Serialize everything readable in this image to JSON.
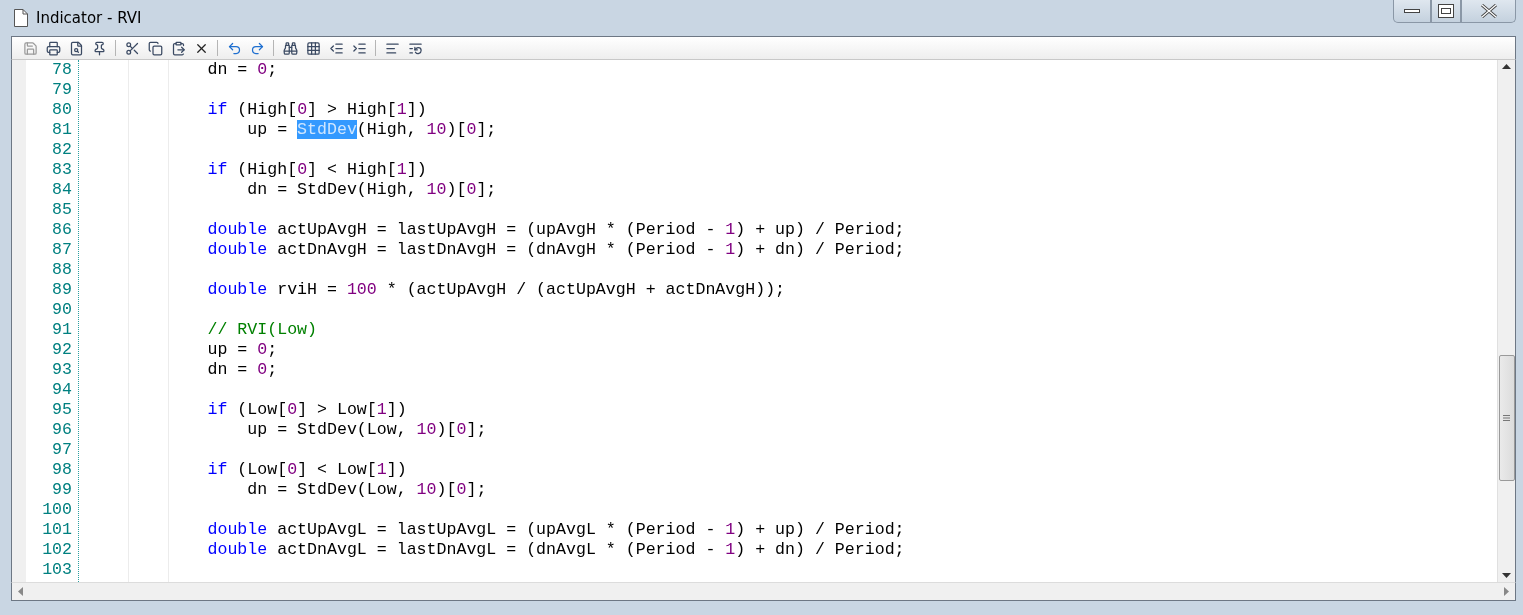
{
  "window": {
    "title": "Indicator - RVI"
  },
  "editor": {
    "lines": [
      {
        "number": "78",
        "kind": "block",
        "tokens": [
          {
            "kind": "plain",
            "text": "dn = "
          },
          {
            "kind": "number",
            "text": "0"
          },
          {
            "kind": "plain",
            "text": ";"
          }
        ]
      },
      {
        "number": "79"
      },
      {
        "number": "80",
        "kind": "block",
        "tokens": [
          {
            "kind": "keyword",
            "text": "if"
          },
          {
            "kind": "plain",
            "text": " (High["
          },
          {
            "kind": "number",
            "text": "0"
          },
          {
            "kind": "plain",
            "text": "] > High["
          },
          {
            "kind": "number",
            "text": "1"
          },
          {
            "kind": "plain",
            "text": "])"
          }
        ]
      },
      {
        "number": "81",
        "kind": "nested",
        "tokens": [
          {
            "kind": "plain",
            "text": "up = "
          },
          {
            "kind": "selected",
            "text": "StdDev"
          },
          {
            "kind": "plain",
            "text": "(High, "
          },
          {
            "kind": "number",
            "text": "10"
          },
          {
            "kind": "plain",
            "text": ")["
          },
          {
            "kind": "number",
            "text": "0"
          },
          {
            "kind": "plain",
            "text": "];"
          }
        ]
      },
      {
        "number": "82"
      },
      {
        "number": "83",
        "kind": "block",
        "tokens": [
          {
            "kind": "keyword",
            "text": "if"
          },
          {
            "kind": "plain",
            "text": " (High["
          },
          {
            "kind": "number",
            "text": "0"
          },
          {
            "kind": "plain",
            "text": "] < High["
          },
          {
            "kind": "number",
            "text": "1"
          },
          {
            "kind": "plain",
            "text": "])"
          }
        ]
      },
      {
        "number": "84",
        "kind": "nested",
        "tokens": [
          {
            "kind": "plain",
            "text": "dn = StdDev(High, "
          },
          {
            "kind": "number",
            "text": "10"
          },
          {
            "kind": "plain",
            "text": ")["
          },
          {
            "kind": "number",
            "text": "0"
          },
          {
            "kind": "plain",
            "text": "];"
          }
        ]
      },
      {
        "number": "85"
      },
      {
        "number": "86",
        "kind": "block",
        "tokens": [
          {
            "kind": "keyword",
            "text": "double"
          },
          {
            "kind": "plain",
            "text": " actUpAvgH = lastUpAvgH = (upAvgH * (Period - "
          },
          {
            "kind": "number",
            "text": "1"
          },
          {
            "kind": "plain",
            "text": ") + up) / Period;"
          }
        ]
      },
      {
        "number": "87",
        "kind": "block",
        "tokens": [
          {
            "kind": "keyword",
            "text": "double"
          },
          {
            "kind": "plain",
            "text": " actDnAvgH = lastDnAvgH = (dnAvgH * (Period - "
          },
          {
            "kind": "number",
            "text": "1"
          },
          {
            "kind": "plain",
            "text": ") + dn) / Period;"
          }
        ]
      },
      {
        "number": "88"
      },
      {
        "number": "89",
        "kind": "block",
        "tokens": [
          {
            "kind": "keyword",
            "text": "double"
          },
          {
            "kind": "plain",
            "text": " rviH = "
          },
          {
            "kind": "number",
            "text": "100"
          },
          {
            "kind": "plain",
            "text": " * (actUpAvgH / (actUpAvgH + actDnAvgH));"
          }
        ]
      },
      {
        "number": "90"
      },
      {
        "number": "91",
        "kind": "block",
        "tokens": [
          {
            "kind": "comment",
            "text": "// RVI(Low)"
          }
        ]
      },
      {
        "number": "92",
        "kind": "block",
        "tokens": [
          {
            "kind": "plain",
            "text": "up = "
          },
          {
            "kind": "number",
            "text": "0"
          },
          {
            "kind": "plain",
            "text": ";"
          }
        ]
      },
      {
        "number": "93",
        "kind": "block",
        "tokens": [
          {
            "kind": "plain",
            "text": "dn = "
          },
          {
            "kind": "number",
            "text": "0"
          },
          {
            "kind": "plain",
            "text": ";"
          }
        ]
      },
      {
        "number": "94"
      },
      {
        "number": "95",
        "kind": "block",
        "tokens": [
          {
            "kind": "keyword",
            "text": "if"
          },
          {
            "kind": "plain",
            "text": " (Low["
          },
          {
            "kind": "number",
            "text": "0"
          },
          {
            "kind": "plain",
            "text": "] > Low["
          },
          {
            "kind": "number",
            "text": "1"
          },
          {
            "kind": "plain",
            "text": "])"
          }
        ]
      },
      {
        "number": "96",
        "kind": "nested",
        "tokens": [
          {
            "kind": "plain",
            "text": "up = StdDev(Low, "
          },
          {
            "kind": "number",
            "text": "10"
          },
          {
            "kind": "plain",
            "text": ")["
          },
          {
            "kind": "number",
            "text": "0"
          },
          {
            "kind": "plain",
            "text": "];"
          }
        ]
      },
      {
        "number": "97"
      },
      {
        "number": "98",
        "kind": "block",
        "tokens": [
          {
            "kind": "keyword",
            "text": "if"
          },
          {
            "kind": "plain",
            "text": " (Low["
          },
          {
            "kind": "number",
            "text": "0"
          },
          {
            "kind": "plain",
            "text": "] < Low["
          },
          {
            "kind": "number",
            "text": "1"
          },
          {
            "kind": "plain",
            "text": "])"
          }
        ]
      },
      {
        "number": "99",
        "kind": "nested",
        "tokens": [
          {
            "kind": "plain",
            "text": "dn = StdDev(Low, "
          },
          {
            "kind": "number",
            "text": "10"
          },
          {
            "kind": "plain",
            "text": ")["
          },
          {
            "kind": "number",
            "text": "0"
          },
          {
            "kind": "plain",
            "text": "];"
          }
        ]
      },
      {
        "number": "100"
      },
      {
        "number": "101",
        "kind": "block",
        "tokens": [
          {
            "kind": "keyword",
            "text": "double"
          },
          {
            "kind": "plain",
            "text": " actUpAvgL = lastUpAvgL = (upAvgL * (Period - "
          },
          {
            "kind": "number",
            "text": "1"
          },
          {
            "kind": "plain",
            "text": ") + up) / Period;"
          }
        ]
      },
      {
        "number": "102",
        "kind": "block",
        "tokens": [
          {
            "kind": "keyword",
            "text": "double"
          },
          {
            "kind": "plain",
            "text": " actDnAvgL = lastDnAvgL = (dnAvgL * (Period - "
          },
          {
            "kind": "number",
            "text": "1"
          },
          {
            "kind": "plain",
            "text": ") + dn) / Period;"
          }
        ]
      },
      {
        "number": "103"
      }
    ]
  }
}
